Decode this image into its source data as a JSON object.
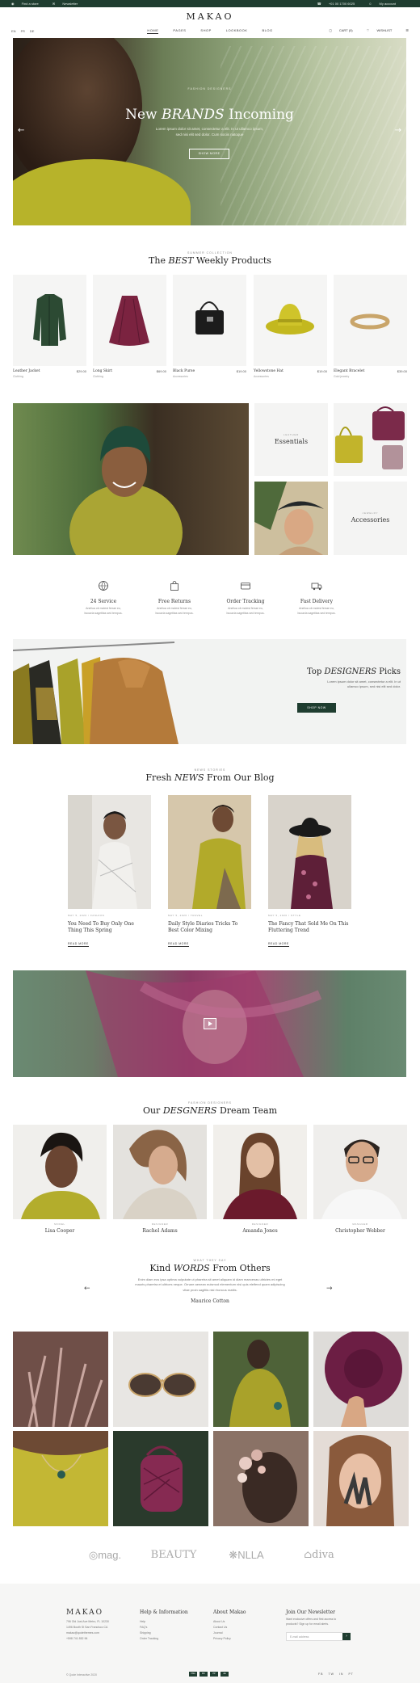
{
  "topbar": {
    "find_store": "Find a store",
    "newsletter": "Newsletter",
    "phone": "+01 00 1700 6025",
    "account": "My account"
  },
  "logo": "MAKAO",
  "langs": [
    "EN",
    "FR",
    "DE"
  ],
  "nav": [
    "HOME",
    "PAGES",
    "SHOP",
    "LOOKBOOK",
    "BLOG"
  ],
  "account_nav": {
    "cart": "CART (0)",
    "wishlist": "WISHLIST"
  },
  "hero": {
    "subtitle": "FASHION DESIGNERS",
    "title_pre": "New",
    "title_em": "BRANDS",
    "title_post": "Incoming",
    "text_1": "Lorem ipsum dolor sit amet, consectetur a elit. In ut ullamco ipsum,",
    "text_2": "sed nisi elit sed dolor. Cum sociis natoque",
    "button": "SHOW MORE"
  },
  "weekly": {
    "subtitle": "SUMMER COLLECTION",
    "title_pre": "The",
    "title_em": "BEST",
    "title_post": "Weekly Products"
  },
  "products": [
    {
      "name": "Leather Jacket",
      "category": "Clothing",
      "price": "$29.00"
    },
    {
      "name": "Long Skirt",
      "category": "Clothing",
      "price": "$69.00"
    },
    {
      "name": "Black Purse",
      "category": "Accessories",
      "price": "$19.00"
    },
    {
      "name": "Yellowstone Hat",
      "category": "Accessories",
      "price": "$19.00"
    },
    {
      "name": "Elegant Bracelet",
      "category": "Gold jewelry",
      "price": "$39.00"
    }
  ],
  "collections": {
    "essentials_sub": "LEATHER",
    "essentials": "Essentials",
    "accessories_sub": "JEWELRY",
    "accessories": "Accessories"
  },
  "features": [
    {
      "title": "24 Service",
      "text_1": "Aneliua ob molest ferrae eu,",
      "text_2": "bucavia sagetitas sed tempus."
    },
    {
      "title": "Free Returns",
      "text_1": "Aneliua ob molest ferrae eu,",
      "text_2": "bucavia sagetitas sed tempus."
    },
    {
      "title": "Order Tracking",
      "text_1": "Aneliua ob molest ferrae eu,",
      "text_2": "bucavia sagetitas sed tempus."
    },
    {
      "title": "Fast Delivery",
      "text_1": "Aneliua ob molest ferrae eu,",
      "text_2": "bucavia sagetitas sed tempus."
    }
  ],
  "designers_banner": {
    "title_pre": "Top",
    "title_em": "DESIGNERS",
    "title_post": "Picks",
    "text_1": "Lorem ipsum dolor sit amet, consectetur a elit. In ut",
    "text_2": "ullamco ipsum, sed nisi elit sed dolor.",
    "button": "SHOP NOW"
  },
  "blog": {
    "subtitle": "NEWS STORIES",
    "title_pre": "Fresh",
    "title_em": "NEWS",
    "title_post": "From Our Blog",
    "posts": [
      {
        "meta": "MAY 5, 2020 / FASHION",
        "title": "You Need To Buy Only One Thing This Spring",
        "more": "READ MORE"
      },
      {
        "meta": "MAY 5, 2020 / TRAVEL",
        "title": "Daily Style Diaries Tricks To Best Color Mixing",
        "more": "READ MORE"
      },
      {
        "meta": "MAY 5, 2020 / STYLE",
        "title": "The Fancy That Sold Me On This Fluttering Trend",
        "more": "READ MORE"
      }
    ]
  },
  "team": {
    "subtitle": "FASHION DESIGNERS",
    "title_pre": "Our",
    "title_em": "DESGNERS",
    "title_post": "Dream Team",
    "members": [
      {
        "role": "MODEL",
        "name": "Lisa Cooper"
      },
      {
        "role": "DESIGNER",
        "name": "Rachel Adams"
      },
      {
        "role": "DESIGNER",
        "name": "Amanda Jones"
      },
      {
        "role": "MANAGER",
        "name": "Christopher Webber"
      }
    ]
  },
  "testimonial": {
    "subtitle": "WHAT THEY SAY",
    "title_pre": "Kind",
    "title_em": "WORDS",
    "title_post": "From Others",
    "text_1": "Enim diam eos ipsa optima vulputate ut pharetra sit amet aliquam id diam maecenas ultricies mi eget",
    "text_2": "mauris pharetra et ultrices neque. Ornare aenean euismod elementum nisi quis eleifend quam adipiscing",
    "text_3": "vitae proin sagittis nisl rhoncus mattis.",
    "author": "Maurice Cotton"
  },
  "brands": [
    "mag.",
    "BEAUTY",
    "NLLA",
    "diva"
  ],
  "footer": {
    "logo": "MAKAO",
    "address": [
      "796 Old Just Ave Metro, FL 10230",
      "1496 Booth St San Francisco CA"
    ],
    "email": "makao@qodethemes.com",
    "phone": "+598 741 852 96",
    "help_title": "Help & Information",
    "help_links": [
      "Help",
      "FAQ's",
      "Shipping",
      "Order Tracking"
    ],
    "about_title": "About Makao",
    "about_links": [
      "About Us",
      "Contact Us",
      "Journal",
      "Privacy Policy"
    ],
    "news_title": "Join Our Newsletter",
    "news_text_1": "Want exclusive offers and first access to",
    "news_text_2": "products? Sign up for email alerts.",
    "email_placeholder": "E-mail address",
    "copyright": "© Qode Interactive 2020",
    "payments": [
      "VISA",
      "MC",
      "PP",
      "AE"
    ],
    "social": [
      "FB",
      "TW",
      "IN",
      "PT"
    ]
  }
}
